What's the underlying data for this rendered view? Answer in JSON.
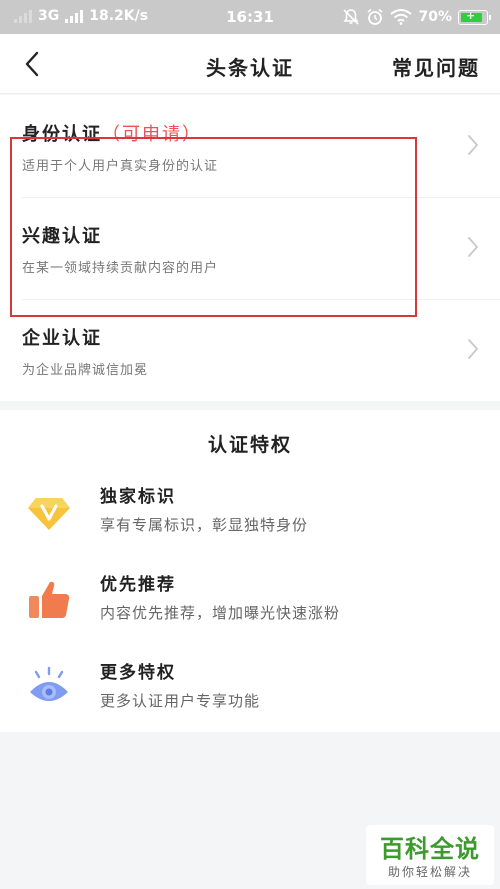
{
  "status_bar": {
    "network_type": "3G",
    "speed": "18.2K/s",
    "time": "16:31",
    "battery": "70%",
    "battery_color": "#2ecf3c"
  },
  "nav": {
    "back_icon": "chevron-left-icon",
    "title": "头条认证",
    "faq_label": "常见问题"
  },
  "certifications": [
    {
      "title": "身份认证",
      "badge": "（可申请）",
      "desc": "适用于个人用户真实身份的认证"
    },
    {
      "title": "兴趣认证",
      "desc": "在某一领域持续贡献内容的用户"
    },
    {
      "title": "企业认证",
      "desc": "为企业品牌诚信加冕"
    }
  ],
  "perks": {
    "title": "认证特权",
    "items": [
      {
        "icon": "diamond-v-icon",
        "title": "独家标识",
        "desc": "享有专属标识，彰显独特身份"
      },
      {
        "icon": "thumbs-up-icon",
        "title": "优先推荐",
        "desc": "内容优先推荐，增加曝光快速涨粉"
      },
      {
        "icon": "eye-icon",
        "title": "更多特权",
        "desc": "更多认证用户专享功能"
      }
    ]
  },
  "watermark": {
    "main": "百科全说",
    "sub": "助你轻松解决"
  },
  "colors": {
    "accent_red": "#f0504f",
    "highlight_border": "#d43a3a",
    "watermark_green": "#3d9a2d"
  }
}
